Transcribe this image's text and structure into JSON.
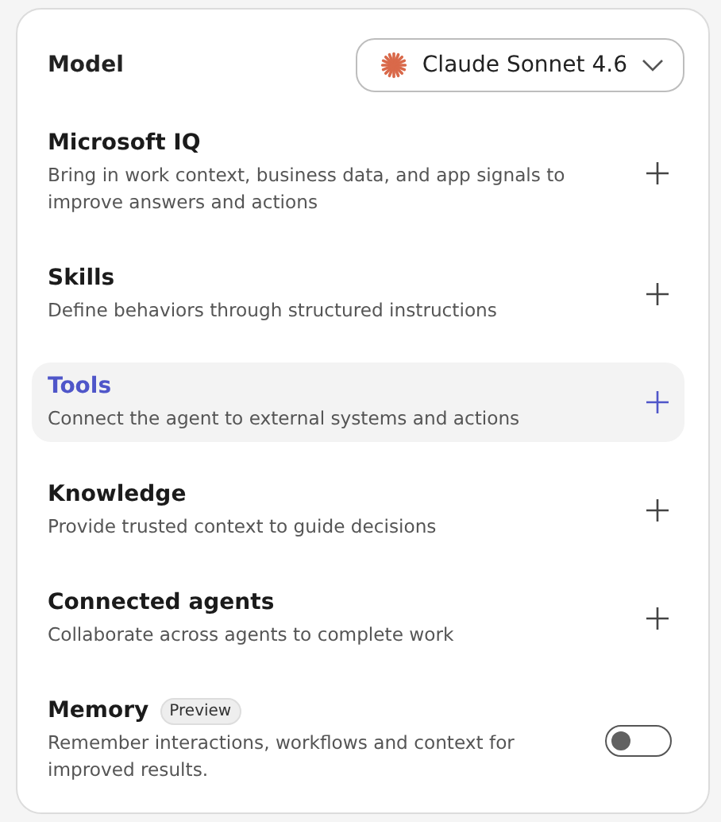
{
  "model": {
    "label": "Model",
    "value": "Claude Sonnet 4.6"
  },
  "sections": [
    {
      "kind": "add",
      "title": "Microsoft IQ",
      "description": "Bring in work context, business data, and app signals to improve answers and actions",
      "selected": false
    },
    {
      "kind": "add",
      "title": "Skills",
      "description": "Define behaviors through structured instructions",
      "selected": false
    },
    {
      "kind": "add",
      "title": "Tools",
      "description": "Connect the agent to external systems and actions",
      "selected": true
    },
    {
      "kind": "add",
      "title": "Knowledge",
      "description": "Provide trusted context to guide decisions",
      "selected": false
    },
    {
      "kind": "add",
      "title": "Connected agents",
      "description": "Collaborate across agents to complete work",
      "selected": false
    },
    {
      "kind": "toggle",
      "title": "Memory",
      "badge": "Preview",
      "description": "Remember interactions, workflows and context for improved results.",
      "selected": false,
      "on": false
    }
  ]
}
